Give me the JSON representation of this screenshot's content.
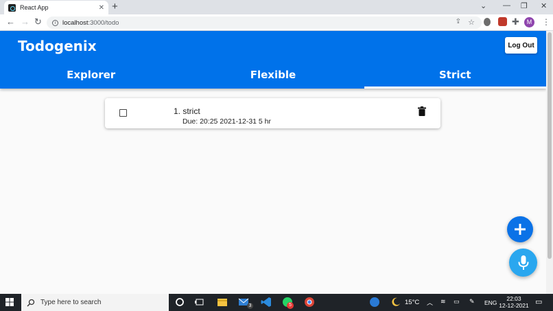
{
  "browser": {
    "tab_title": "React App",
    "url_host": "localhost",
    "url_path": ":3000/todo",
    "avatar_letter": "M"
  },
  "app": {
    "brand": "Todogenix",
    "logout_label": "Log Out",
    "tabs": [
      {
        "label": "Explorer",
        "active": false
      },
      {
        "label": "Flexible",
        "active": false
      },
      {
        "label": "Strict",
        "active": true
      }
    ],
    "todos": [
      {
        "title": "1. strict",
        "due": "Due: 20:25 2021-12-31 5 hr",
        "checked": false
      }
    ],
    "colors": {
      "header": "#0072ea",
      "fab_add": "#0b72e7",
      "fab_mic": "#2aa7ef"
    }
  },
  "taskbar": {
    "search_placeholder": "Type here to search",
    "temperature": "15°C",
    "language": "ENG",
    "time": "22:03",
    "date": "12-12-2021",
    "mail_badge": "3",
    "whatsapp_badge": "5"
  }
}
